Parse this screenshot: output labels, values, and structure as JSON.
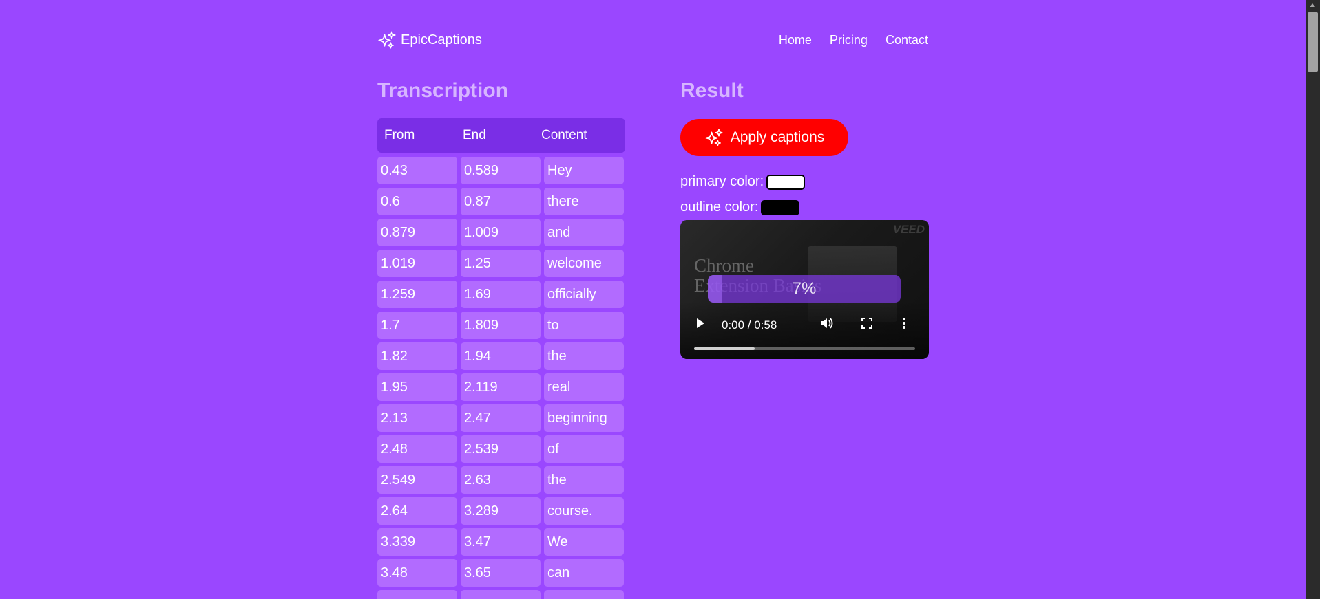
{
  "header": {
    "brand": "EpicCaptions",
    "nav": [
      "Home",
      "Pricing",
      "Contact"
    ]
  },
  "transcription": {
    "title": "Transcription",
    "columns": [
      "From",
      "End",
      "Content"
    ],
    "rows": [
      [
        "0.43",
        "0.589",
        "Hey"
      ],
      [
        "0.6",
        "0.87",
        "there"
      ],
      [
        "0.879",
        "1.009",
        "and"
      ],
      [
        "1.019",
        "1.25",
        "welcome"
      ],
      [
        "1.259",
        "1.69",
        "officially"
      ],
      [
        "1.7",
        "1.809",
        "to"
      ],
      [
        "1.82",
        "1.94",
        "the"
      ],
      [
        "1.95",
        "2.119",
        "real"
      ],
      [
        "2.13",
        "2.47",
        "beginning"
      ],
      [
        "2.48",
        "2.539",
        "of"
      ],
      [
        "2.549",
        "2.63",
        "the"
      ],
      [
        "2.64",
        "3.289",
        "course."
      ],
      [
        "3.339",
        "3.47",
        "We"
      ],
      [
        "3.48",
        "3.65",
        "can"
      ],
      [
        "",
        "",
        ""
      ]
    ]
  },
  "result": {
    "title": "Result",
    "apply_label": "Apply captions",
    "primary_color_label": "primary color:",
    "primary_color": "#ffffff",
    "outline_color_label": "outline color:",
    "outline_color": "#000000"
  },
  "video": {
    "progress_label": "7%",
    "progress": 0.07,
    "time": "0:00 / 0:58",
    "watermark": "VEED",
    "frame_text": "Chrome Extension Basics"
  },
  "colors": {
    "background": "#9a47ff",
    "table_header": "#7a2ee6",
    "cell": "#b26bff",
    "apply_button": "#ff0000"
  }
}
